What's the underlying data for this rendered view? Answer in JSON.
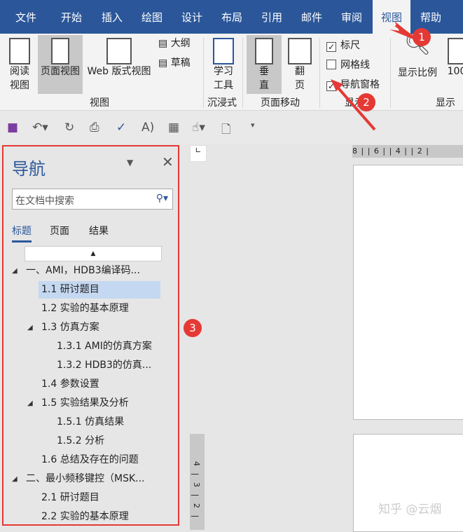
{
  "tabs": [
    "文件",
    "开始",
    "插入",
    "绘图",
    "设计",
    "布局",
    "引用",
    "邮件",
    "审阅",
    "视图",
    "帮助"
  ],
  "ribbon": {
    "read_view": [
      "阅读",
      "视图"
    ],
    "page_view": "页面视图",
    "web_view": "Web 版式视图",
    "outline": "大纲",
    "draft": "草稿",
    "views_group": "视图",
    "learning": [
      "学习",
      "工具"
    ],
    "immersive_group": "沉浸式",
    "vertical": [
      "垂",
      "直"
    ],
    "flip": [
      "翻",
      "页"
    ],
    "page_move_group": "页面移动",
    "ruler": "标尺",
    "gridlines": "网格线",
    "nav_pane": "导航窗格",
    "show_group": "显示",
    "zoom": "显示比例",
    "zoom100": "100",
    "zoom_group": "显示比"
  },
  "checks": {
    "ruler": true,
    "gridlines": false,
    "nav_pane": true
  },
  "badges": [
    "1",
    "2",
    "3"
  ],
  "nav": {
    "title": "导航",
    "search_placeholder": "在文档中搜索",
    "tabs": [
      "标题",
      "页面",
      "结果"
    ],
    "items": [
      {
        "text": "一、AMI，HDB3编译码...",
        "level": 0,
        "expand": true
      },
      {
        "text": "1.1 研讨题目",
        "level": 1,
        "selected": true
      },
      {
        "text": "1.2 实验的基本原理",
        "level": 1
      },
      {
        "text": "1.3 仿真方案",
        "level": 1,
        "expand": true
      },
      {
        "text": "1.3.1 AMI的仿真方案",
        "level": 2
      },
      {
        "text": "1.3.2 HDB3的仿真...",
        "level": 2
      },
      {
        "text": "1.4 参数设置",
        "level": 1
      },
      {
        "text": "1.5 实验结果及分析",
        "level": 1,
        "expand": true
      },
      {
        "text": "1.5.1 仿真结果",
        "level": 2
      },
      {
        "text": "1.5.2 分析",
        "level": 2
      },
      {
        "text": "1.6 总结及存在的问题",
        "level": 1
      },
      {
        "text": "二、最小频移键控（MSK...",
        "level": 0,
        "expand": true
      },
      {
        "text": "2.1 研讨题目",
        "level": 1
      },
      {
        "text": "2.2 实验的基本原理",
        "level": 1
      }
    ]
  },
  "ruler_text": "8 |   | 6 |   | 4 |   | 2 |",
  "vruler": [
    "4",
    "|",
    "3",
    "|",
    "2",
    "|"
  ],
  "watermark": "知乎 @云烟"
}
